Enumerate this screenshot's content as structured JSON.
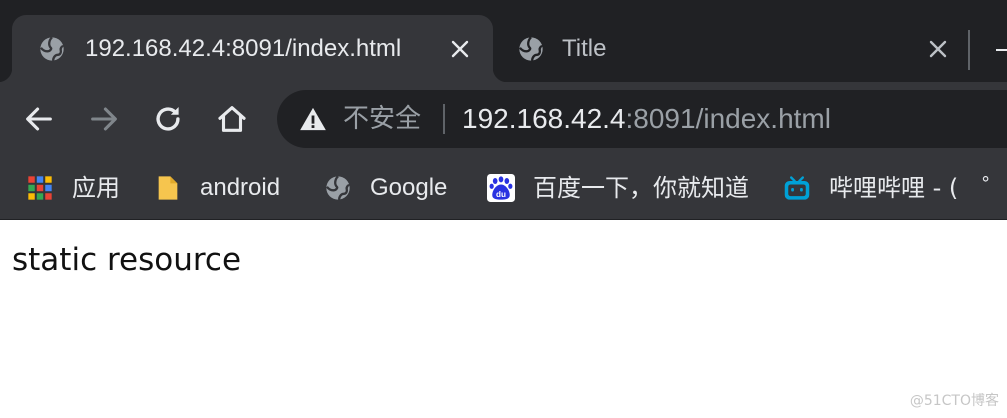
{
  "tabs": [
    {
      "title": "192.168.42.4:8091/index.html",
      "active": true
    },
    {
      "title": "Title",
      "active": false
    }
  ],
  "icons": {
    "tab_favicon": "globe-icon",
    "tab_close": "close-icon",
    "back": "arrow-left-icon",
    "forward": "arrow-right-icon",
    "reload": "reload-icon",
    "home": "home-icon",
    "security": "warning-triangle-icon"
  },
  "omnibox": {
    "security_label": "不安全",
    "url_host": "192.168.42.4",
    "url_rest": ":8091/index.html"
  },
  "bookmarks": [
    {
      "label": "应用",
      "icon": "apps-grid-icon"
    },
    {
      "label": "android",
      "icon": "folder-icon"
    },
    {
      "label": "Google",
      "icon": "globe-icon"
    },
    {
      "label": "百度一下，你就知道",
      "icon": "baidu-paw-icon"
    },
    {
      "label": "哔哩哔哩 - (　゜-",
      "icon": "bilibili-tv-icon"
    }
  ],
  "page": {
    "body_text": "static resource",
    "watermark": "@51CTO博客"
  },
  "colors": {
    "tabstrip_bg": "#202124",
    "toolbar_bg": "#35363a",
    "omnibox_bg": "#202124",
    "text_primary": "#e8eaed",
    "text_muted": "#9aa0a6"
  }
}
